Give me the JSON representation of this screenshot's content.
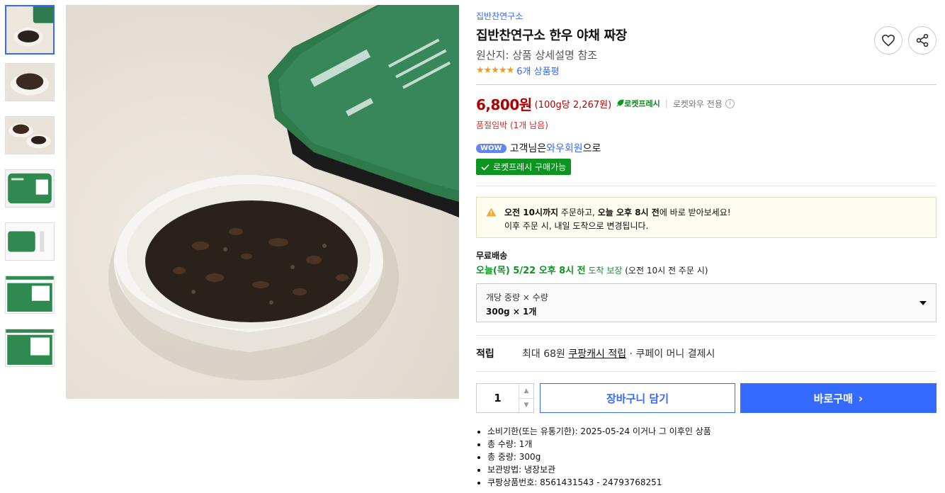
{
  "product": {
    "brand": "집반찬연구소",
    "title": "집반찬연구소 한우 야채 짜장",
    "origin": "원산지: 상품 상세설명 참조",
    "rating_stars": 4.5,
    "review_count": "6개 상품평"
  },
  "price": {
    "amount": "6,800원",
    "unit_price": "(100g당 2,267원)",
    "rocket_fresh": "로켓프레시",
    "wow_only": "로켓와우 전용",
    "stock_notice": "품절임박 (1개 남음)"
  },
  "membership": {
    "badge": "WOW",
    "text_pre": "고객님은 ",
    "link": "와우회원",
    "text_post": "으로",
    "rocket_badge": "로켓프레시 구매가능"
  },
  "notice": {
    "line1_bold1": "오전 10시까지",
    "line1_mid": " 주문하고, ",
    "line1_bold2": "오늘 오후 8시 전",
    "line1_end": "에 바로 받아보세요!",
    "line2": "이후 주문 시, 내일 도착으로 변경됩니다."
  },
  "shipping": {
    "label": "무료배송",
    "date": "오늘(목) 5/22 오후 8시 전",
    "guarantee": " 도착 보장",
    "condition": " (오전 10시 전 주문 시)"
  },
  "option": {
    "label": "개당 중량 × 수량",
    "value": "300g × 1개"
  },
  "points": {
    "label": "적립",
    "prefix": "최대 68원 ",
    "link": "쿠팡캐시 적립",
    "suffix": " · 쿠페이 머니 결제시"
  },
  "purchase": {
    "quantity": "1",
    "cart_label": "장바구니 담기",
    "buy_label": "바로구매"
  },
  "details": [
    "소비기한(또는 유통기한): 2025-05-24 이거나 그 이후인 상품",
    "총 수량: 1개",
    "총 중량: 300g",
    "보관방법: 냉장보관",
    "쿠팡상품번호: 8561431543 - 24793768251"
  ],
  "colors": {
    "accent": "#346aff",
    "price": "#ae0000",
    "rocket_green": "#0e9420",
    "star": "#f39c1f"
  }
}
